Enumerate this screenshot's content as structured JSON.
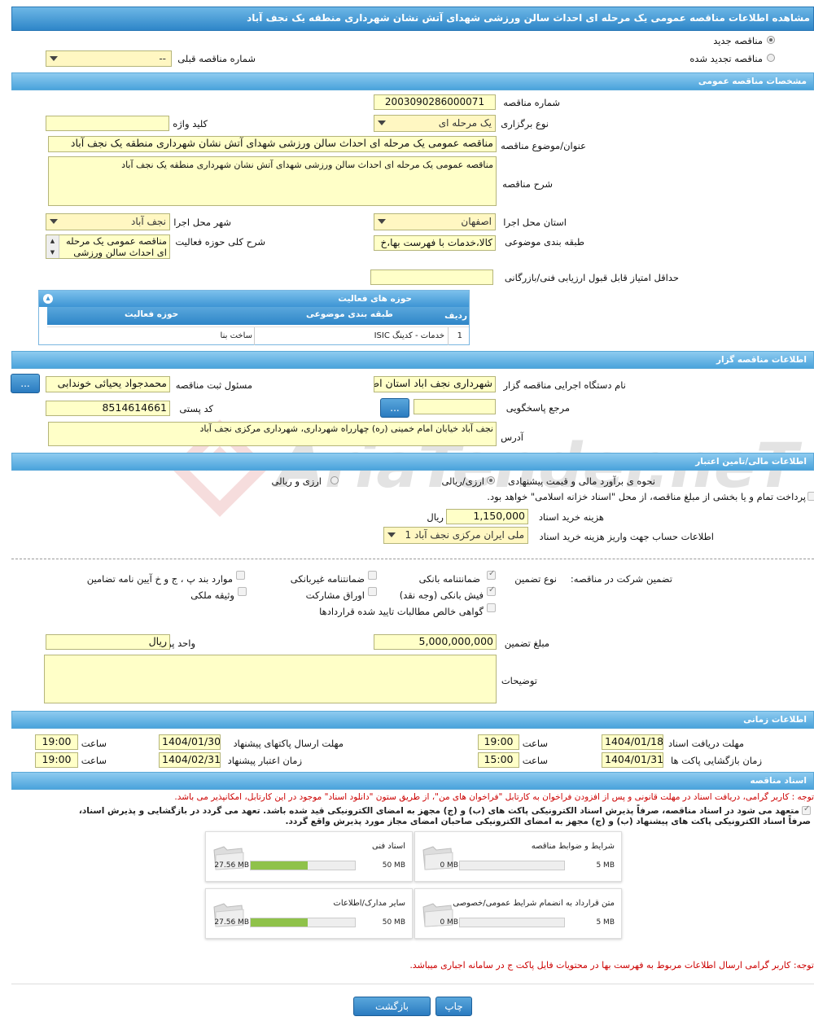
{
  "page_title": "مشاهده اطلاعات مناقصه عمومی یک مرحله ای احداث سالن ورزشی شهدای آتش نشان شهرداری منطقه یک نجف آباد",
  "top": {
    "new_tender": "مناقصه جدید",
    "renewed_tender": "مناقصه تجدید شده",
    "prev_number_label": "شماره مناقصه قبلی",
    "prev_number_value": "--"
  },
  "general": {
    "header": "مشخصات مناقصه عمومی",
    "number_label": "شماره مناقصه",
    "number_value": "2003090286000071",
    "type_label": "نوع برگزاری",
    "type_value": "یک مرحله ای",
    "keyword_label": "کلید واژه",
    "keyword_value": "",
    "subject_label": "عنوان/موضوع مناقصه",
    "subject_value": "مناقصه عمومی یک مرحله ای احداث سالن ورزشی شهدای آتش نشان شهرداری منطقه یک نجف آباد",
    "desc_label": "شرح مناقصه",
    "desc_value": "مناقصه عمومی یک مرحله ای احداث سالن ورزشی شهدای آتش نشان شهرداری منطقه یک نجف آباد",
    "province_label": "استان محل اجرا",
    "province_value": "اصفهان",
    "city_label": "شهر محل اجرا",
    "city_value": "نجف آباد",
    "category_label": "طبقه بندی موضوعی",
    "category_value": "کالا،خدمات با فهرست بها،خ",
    "scope_label": "شرح کلی حوزه فعالیت",
    "scope_value": "مناقصه عمومی یک مرحله ای احداث سالن ورزشی",
    "min_score_label": "حداقل امتیاز قابل قبول ارزیابی فنی/بازرگانی",
    "min_score_value": ""
  },
  "activity": {
    "title": "حوزه های فعالیت",
    "col_row": "ردیف",
    "col_cat": "طبقه بندی موضوعی",
    "col_field": "حوزه فعالیت",
    "rows": [
      {
        "n": "1",
        "cat": "خدمات - کدینگ ISIC",
        "field": "ساخت بنا"
      }
    ]
  },
  "organizer": {
    "header": "اطلاعات مناقصه گزار",
    "org_label": "نام دستگاه اجرایی مناقصه گزار",
    "org_value": "شهرداری نجف اباد استان اصفهان",
    "resp_label": "مسئول ثبت مناقصه",
    "resp_value": "محمدجواد یحیائی خوندابی",
    "ref_label": "مرجع پاسخگویی",
    "ref_value": "",
    "postal_label": "کد پستی",
    "postal_value": "8514614661",
    "address_label": "آدرس",
    "address_value": "نجف آباد خیابان امام خمینی (ره) چهارراه شهرداری، شهرداری مرکزی نجف آباد",
    "btn": "..."
  },
  "finance": {
    "header": "اطلاعات مالی/تامین اعتبار",
    "method_label": "نحوه ی برآورد مالی و قیمت پیشنهادی",
    "opt1": "ارزی/ریالی",
    "opt2": "ارزی و ریالی",
    "treasury": "پرداخت تمام و یا بخشی از مبلغ مناقصه، از محل \"اسناد خزانه اسلامی\" خواهد بود.",
    "fee_label": "هزینه خرید اسناد",
    "fee_value": "1,150,000",
    "fee_unit": "ریال",
    "account_label": "اطلاعات حساب جهت واریز هزینه خرید اسناد",
    "account_value": "ملی ایران مرکزی نجف آباد 1"
  },
  "guarantee": {
    "label": "تضمین شرکت در مناقصه:",
    "type_label": "نوع تضمین",
    "bank": "ضمانتنامه بانکی",
    "nonbank": "ضمانتنامه غیربانکی",
    "clauses": "موارد بند پ ، ج و خ آیین نامه تضامین",
    "receipt": "فیش بانکی (وجه نقد)",
    "bonds": "اوراق مشارکت",
    "property": "وثیقه ملکی",
    "certificate": "گواهی خالص مطالبات تایید شده قراردادها",
    "amount_label": "مبلغ تضمین",
    "amount_value": "5,000,000,000",
    "currency_label": "واحد پول",
    "currency_value": "ریال",
    "notes_label": "توضیحات"
  },
  "time": {
    "header": "اطلاعات زمانی",
    "receive_label": "مهلت دریافت اسناد",
    "receive_date": "1404/01/18",
    "receive_time": "19:00",
    "send_label": "مهلت ارسال پاکتهای پیشنهاد",
    "send_date": "1404/01/30",
    "send_time": "19:00",
    "open_label": "زمان بازگشایی پاکت ها",
    "open_date": "1404/01/31",
    "open_time": "15:00",
    "valid_label": "زمان اعتبار پیشنهاد",
    "valid_date": "1404/02/31",
    "valid_time": "19:00",
    "time_label": "ساعت"
  },
  "docs": {
    "header": "اسناد مناقصه",
    "notice": "توجه : کاربر گرامی، دریافت اسناد در مهلت قانونی و پس از افزودن فراخوان به کارتابل \"فراخوان های من\"، از طریق ستون \"دانلود اسناد\" موجود در این کارتابل، امکانپذیر می باشد.",
    "commit1": "متعهد می شود در اسناد مناقصه، صرفاً پذیرش اسناد الکترونیکی پاکت های (ب) و (ج) مجهز به امضای الکترونیکی قید شده باشد. تعهد می گردد در بازگشایی و پذیرش اسناد،",
    "commit2": "صرفاً اسناد الکترونیکی پاکت های پیشنهاد (ب) و (ج) مجهز به امضای الکترونیکی صاحبان امضای مجاز مورد پذیرش واقع گردد.",
    "files": [
      {
        "title": "شرایط و ضوابط مناقصه",
        "size": "0 MB",
        "max": "5 MB",
        "fill": 0
      },
      {
        "title": "اسناد فنی",
        "size": "27.56 MB",
        "max": "50 MB",
        "fill": 0.55
      },
      {
        "title": "متن قرارداد به انضمام شرایط عمومی/خصوصی",
        "size": "0 MB",
        "max": "5 MB",
        "fill": 0
      },
      {
        "title": "سایر مدارک/اطلاعات",
        "size": "27.56 MB",
        "max": "50 MB",
        "fill": 0.55
      }
    ],
    "bottom_notice": "توجه: کاربر گرامی ارسال اطلاعات مربوط به فهرست بها در محتویات فایل پاکت ج در سامانه اجباری میباشد."
  },
  "watermark": "AriaTender.neT",
  "buttons": {
    "back": "بازگشت",
    "print": "چاپ"
  }
}
